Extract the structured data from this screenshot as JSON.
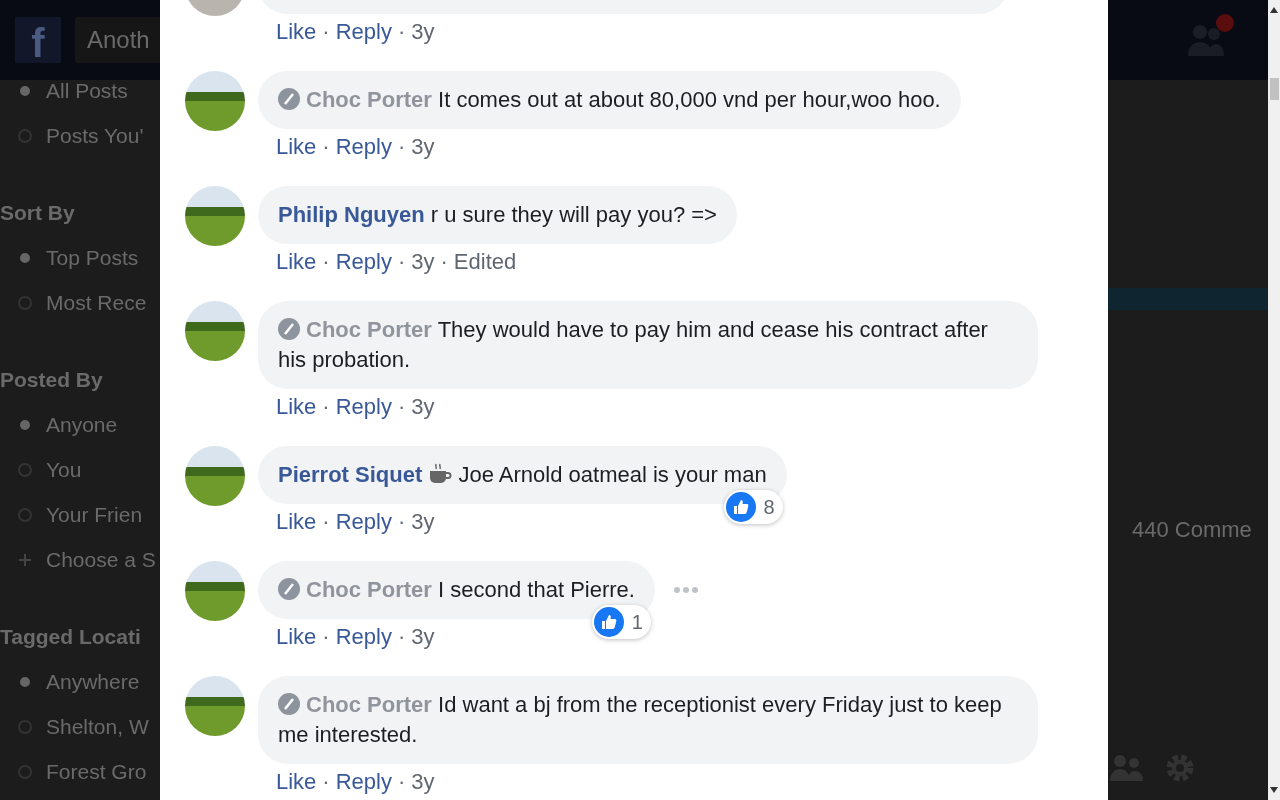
{
  "header": {
    "logo": "f",
    "search": {
      "value": "Anoth"
    }
  },
  "sidebar": {
    "sections": [
      {
        "items": [
          {
            "label": "All Posts",
            "selected": true
          },
          {
            "label": "Posts You'",
            "selected": false
          }
        ]
      },
      {
        "heading": "Sort By",
        "items": [
          {
            "label": "Top Posts",
            "selected": true
          },
          {
            "label": "Most Rece",
            "selected": false
          }
        ]
      },
      {
        "heading": "Posted By",
        "items": [
          {
            "label": "Anyone",
            "selected": true
          },
          {
            "label": "You",
            "selected": false
          },
          {
            "label": "Your Frien",
            "selected": false
          },
          {
            "label": "Choose a S",
            "selected": false,
            "kind": "add"
          }
        ]
      },
      {
        "heading": "Tagged Locati",
        "items": [
          {
            "label": "Anywhere",
            "selected": true
          },
          {
            "label": "Shelton, W",
            "selected": false
          },
          {
            "label": "Forest Gro",
            "selected": false
          }
        ]
      }
    ]
  },
  "background_right": {
    "comment_count": "440 Comme"
  },
  "comments": [
    {
      "partial": true,
      "actions": [
        {
          "kind": "link",
          "text": "Like"
        },
        {
          "kind": "sep",
          "text": "·"
        },
        {
          "kind": "link",
          "text": "Reply"
        },
        {
          "kind": "sep",
          "text": "·"
        },
        {
          "kind": "meta",
          "text": "3y"
        }
      ]
    },
    {
      "author": "Choc Porter",
      "muted": true,
      "text": "It comes out at about 80,000 vnd per hour,woo hoo.",
      "actions": [
        {
          "kind": "link",
          "text": "Like"
        },
        {
          "kind": "sep",
          "text": "·"
        },
        {
          "kind": "link",
          "text": "Reply"
        },
        {
          "kind": "sep",
          "text": "·"
        },
        {
          "kind": "meta",
          "text": "3y"
        }
      ]
    },
    {
      "author": "Philip Nguyen",
      "muted": false,
      "text": "r u sure they will pay you? =>",
      "actions": [
        {
          "kind": "link",
          "text": "Like"
        },
        {
          "kind": "sep",
          "text": "·"
        },
        {
          "kind": "link",
          "text": "Reply"
        },
        {
          "kind": "sep",
          "text": "·"
        },
        {
          "kind": "meta",
          "text": "3y"
        },
        {
          "kind": "sep",
          "text": "·"
        },
        {
          "kind": "meta",
          "text": "Edited"
        }
      ]
    },
    {
      "author": "Choc Porter",
      "muted": true,
      "text": "They would have to pay him and cease his contract after his probation.",
      "actions": [
        {
          "kind": "link",
          "text": "Like"
        },
        {
          "kind": "sep",
          "text": "·"
        },
        {
          "kind": "link",
          "text": "Reply"
        },
        {
          "kind": "sep",
          "text": "·"
        },
        {
          "kind": "meta",
          "text": "3y"
        }
      ]
    },
    {
      "author": "Pierrot Siquet",
      "muted": false,
      "badge": true,
      "text": "Joe Arnold oatmeal is your man",
      "actions": [
        {
          "kind": "link",
          "text": "Like"
        },
        {
          "kind": "sep",
          "text": "·"
        },
        {
          "kind": "link",
          "text": "Reply"
        },
        {
          "kind": "sep",
          "text": "·"
        },
        {
          "kind": "meta",
          "text": "3y"
        }
      ],
      "likes": "8"
    },
    {
      "author": "Choc Porter",
      "muted": true,
      "text": "I second that Pierre.",
      "actions": [
        {
          "kind": "link",
          "text": "Like"
        },
        {
          "kind": "sep",
          "text": "·"
        },
        {
          "kind": "link",
          "text": "Reply"
        },
        {
          "kind": "sep",
          "text": "·"
        },
        {
          "kind": "meta",
          "text": "3y"
        }
      ],
      "likes": "1",
      "more": true
    },
    {
      "author": "Choc Porter",
      "muted": true,
      "text": "Id want a bj from the receptionist every Friday just to keep me interested.",
      "actions": [
        {
          "kind": "link",
          "text": "Like"
        },
        {
          "kind": "sep",
          "text": "·"
        },
        {
          "kind": "link",
          "text": "Reply"
        },
        {
          "kind": "sep",
          "text": "·"
        },
        {
          "kind": "meta",
          "text": "3y"
        }
      ]
    }
  ]
}
